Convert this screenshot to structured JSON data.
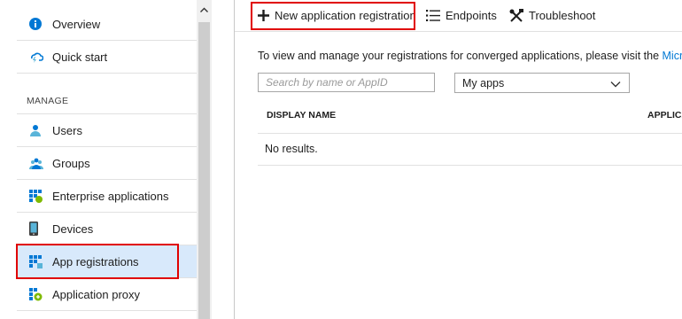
{
  "sidebar": {
    "top_items": [
      {
        "label": "Overview",
        "icon": "info-icon"
      },
      {
        "label": "Quick start",
        "icon": "cloud-lightning-icon"
      }
    ],
    "section_header": "MANAGE",
    "manage_items": [
      {
        "label": "Users",
        "icon": "user-icon"
      },
      {
        "label": "Groups",
        "icon": "groups-icon"
      },
      {
        "label": "Enterprise applications",
        "icon": "enterprise-apps-icon"
      },
      {
        "label": "Devices",
        "icon": "device-icon"
      },
      {
        "label": "App registrations",
        "icon": "app-registrations-icon",
        "active": true
      },
      {
        "label": "Application proxy",
        "icon": "application-proxy-icon"
      }
    ]
  },
  "toolbar": {
    "new_registration_label": "New application registration",
    "endpoints_label": "Endpoints",
    "troubleshoot_label": "Troubleshoot"
  },
  "main": {
    "info_text": "To view and manage your registrations for converged applications, please visit the ",
    "info_link": "Microsof",
    "search_placeholder": "Search by name or AppID",
    "filter_selected": "My apps",
    "columns": [
      "DISPLAY NAME",
      "APPLICA"
    ],
    "empty_message": "No results."
  },
  "colors": {
    "accent": "#0078d4",
    "highlight": "#e00000",
    "active_bg": "#d8e9fb"
  }
}
